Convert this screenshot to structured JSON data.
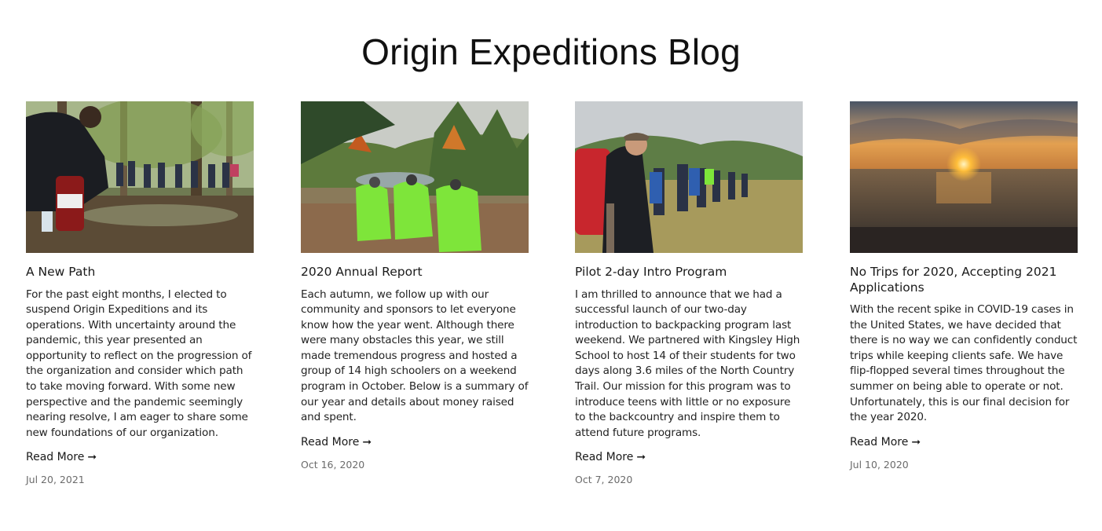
{
  "page": {
    "title": "Origin Expeditions Blog"
  },
  "posts": [
    {
      "title": "A New Path",
      "image_alt": "Guide crouching beside a group of hikers in a forest",
      "excerpt": "For the past eight months, I elected to suspend Origin Expeditions and its operations. With uncertainty around the pandemic, this year presented an opportunity to reflect on the progression of the organization and consider which path to take moving forward. With some new perspective and the pandemic seemingly nearing resolve, I am eager to share some new foundations of our organization.",
      "read_more": "Read More",
      "arrow": "➞",
      "date": "Jul 20, 2021"
    },
    {
      "title": "2020 Annual Report",
      "image_alt": "Three hikers with green pack covers overlooking a lake",
      "excerpt": "Each autumn, we follow up with our community and sponsors to let everyone know how the year went. Although there were many obstacles this year, we still made tremendous progress and hosted a group of 14 high schoolers on a weekend program in October. Below is a summary of our year and details about money raised and spent.",
      "read_more": "Read More",
      "arrow": "➞",
      "date": "Oct 16, 2020"
    },
    {
      "title": "Pilot 2-day Intro Program",
      "image_alt": "Line of backpackers walking through tall grass",
      "excerpt": "I am thrilled to announce that we had a successful launch of our two-day introduction to backpacking program last weekend. We partnered with Kingsley High School to host 14 of their students for two days along 3.6 miles of the North Country Trail. Our mission for this program was to introduce teens with little or no exposure to the backcountry and inspire them to attend future programs.",
      "read_more": "Read More",
      "arrow": "➞",
      "date": "Oct 7, 2020"
    },
    {
      "title": "No Trips for 2020, Accepting 2021 Applications",
      "image_alt": "Sunset over a lake",
      "excerpt": "With the recent spike in COVID-19 cases in the United States, we have decided that there is no way we can confidently conduct trips while keeping clients safe. We have flip-flopped several times throughout the summer on being able to operate or not. Unfortunately, this is our final decision for the year 2020.",
      "read_more": "Read More",
      "arrow": "➞",
      "date": "Jul 10, 2020"
    }
  ]
}
